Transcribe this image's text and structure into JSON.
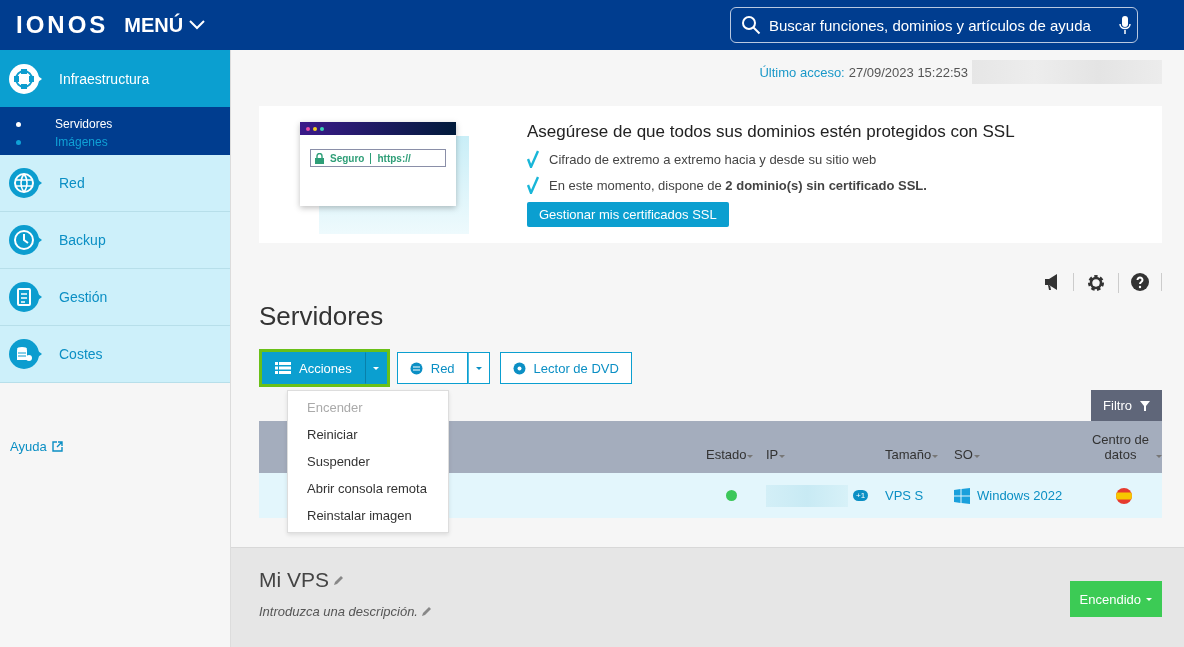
{
  "topbar": {
    "logo": "IONOS",
    "menu": "MENÚ",
    "search": {
      "placeholder": "Buscar funciones, dominios y artículos de ayuda"
    }
  },
  "sidebar": {
    "items": [
      {
        "label": "Infraestructura",
        "selected": true,
        "expanded": true,
        "children": [
          {
            "label": "Servidores",
            "selected": true
          },
          {
            "label": "Imágenes",
            "selected": false
          }
        ]
      },
      {
        "label": "Red",
        "selected": false
      },
      {
        "label": "Backup",
        "selected": false
      },
      {
        "label": "Gestión",
        "selected": false
      },
      {
        "label": "Costes",
        "selected": false
      }
    ],
    "help_link": "Ayuda"
  },
  "last_access": {
    "label": "Último acceso:",
    "value": "27/09/2023 15:22:53"
  },
  "ssl_banner": {
    "title": "Asegúrese de que todos sus dominios estén protegidos con SSL",
    "secure_label": "Seguro",
    "url": "https://",
    "bullets": [
      "Cifrado de extremo a extremo hacia y desde su sitio web",
      "En este momento, dispone de **2 dominio(s) sin certificado SSL.**"
    ],
    "button": "Gestionar mis certificados SSL"
  },
  "page_title": "Servidores",
  "actions": [
    {
      "label": "Acciones",
      "kind": "split",
      "primary": true,
      "highlighted": true
    },
    {
      "label": "Red",
      "kind": "split",
      "primary": false,
      "highlighted": false
    },
    {
      "label": "Lector de DVD",
      "kind": "single",
      "primary": false,
      "highlighted": false
    }
  ],
  "actions_menu": {
    "items": [
      {
        "label": "Encender",
        "disabled": true
      },
      {
        "label": "Reiniciar",
        "disabled": false
      },
      {
        "label": "Suspender",
        "disabled": false
      },
      {
        "label": "Abrir consola remota",
        "disabled": false
      },
      {
        "label": "Reinstalar imagen",
        "disabled": false
      }
    ]
  },
  "filter_button": "Filtro",
  "table": {
    "columns": [
      "Estado",
      "IP",
      "Tamaño",
      "SO",
      "Centro de datos"
    ],
    "rows": [
      {
        "color": "#3cc75a",
        "ip_extra": "+1",
        "size": "VPS S",
        "os": "Windows 2022"
      }
    ]
  },
  "detail": {
    "title": "Mi VPS",
    "description_placeholder": "Introduzca una descripción.",
    "power_button": "Encendido"
  }
}
